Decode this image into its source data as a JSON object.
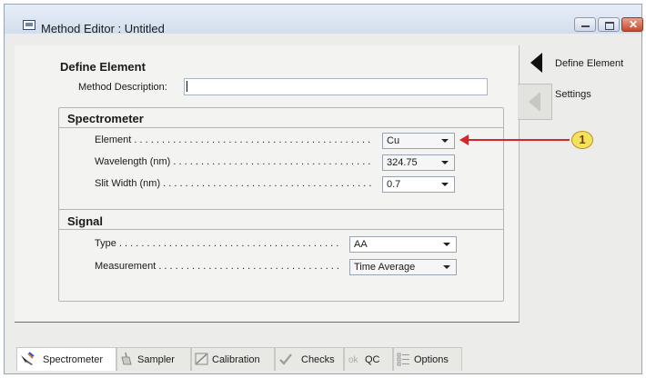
{
  "window": {
    "title": "Method Editor : Untitled"
  },
  "define_element": {
    "title": "Define Element",
    "method_description_label": "Method Description:",
    "method_description_value": ""
  },
  "spectrometer": {
    "title": "Spectrometer",
    "fields": [
      {
        "label": "Element",
        "value": "Cu"
      },
      {
        "label": "Wavelength (nm)",
        "value": "324.75"
      },
      {
        "label": "Slit Width (nm)",
        "value": "0.7"
      }
    ]
  },
  "signal": {
    "title": "Signal",
    "fields": [
      {
        "label": "Type",
        "value": "AA"
      },
      {
        "label": "Measurement",
        "value": "Time Average"
      }
    ]
  },
  "side_tabs": [
    {
      "label": "Define Element",
      "active": true
    },
    {
      "label": "Settings",
      "active": false
    }
  ],
  "annotation": {
    "number": "1",
    "color": "#d3272c"
  },
  "bottom_tabs": [
    {
      "label": "Spectrometer",
      "icon": "spectrometer-icon",
      "active": true
    },
    {
      "label": "Sampler",
      "icon": "sampler-icon",
      "active": false
    },
    {
      "label": "Calibration",
      "icon": "calibration-icon",
      "active": false
    },
    {
      "label": "Checks",
      "icon": "checks-icon",
      "active": false
    },
    {
      "label": "QC",
      "icon": "qc-icon",
      "active": false
    },
    {
      "label": "Options",
      "icon": "options-icon",
      "active": false
    }
  ]
}
